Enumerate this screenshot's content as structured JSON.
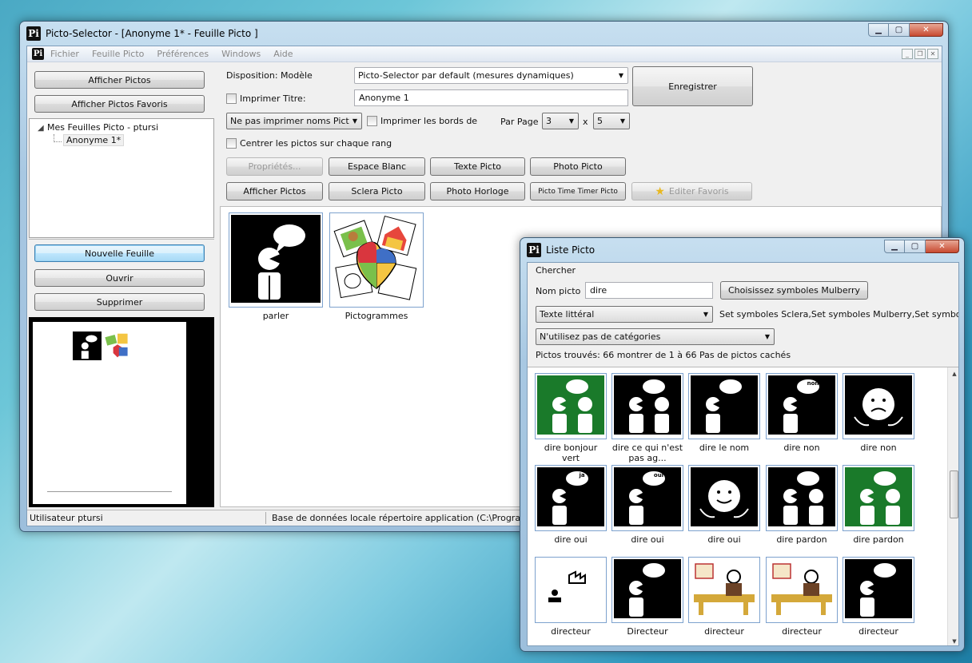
{
  "main_window": {
    "title": "Picto-Selector - [Anonyme 1* - Feuille Picto ]",
    "logo": "Pi",
    "menu": [
      "Fichier",
      "Feuille Picto",
      "Préférences",
      "Windows",
      "Aide"
    ]
  },
  "sidebar": {
    "show_pictos": "Afficher Pictos",
    "show_favorites": "Afficher Pictos Favoris",
    "tree_root": "Mes Feuilles Picto - ptursi",
    "tree_child": "Anonyme 1*",
    "new_sheet": "Nouvelle Feuille",
    "open": "Ouvrir",
    "delete": "Supprimer"
  },
  "options": {
    "layout_label": "Disposition: Modèle",
    "layout_value": "Picto-Selector par default (mesures dynamiques)",
    "save": "Enregistrer",
    "print_title_label": "Imprimer Titre:",
    "title_value": "Anonyme 1",
    "names_select": "Ne pas imprimer noms Pict",
    "print_borders": "Imprimer les bords de",
    "per_page": "Par Page",
    "rows": "3",
    "times": "x",
    "cols": "5",
    "center_label": "Centrer les pictos sur chaque rang"
  },
  "toolbar": {
    "properties": "Propriétés...",
    "white_space": "Espace Blanc",
    "text_picto": "Texte Picto",
    "photo_picto": "Photo Picto",
    "show_pictos": "Afficher Pictos",
    "sclera_picto": "Sclera Picto",
    "photo_clock": "Photo Horloge",
    "time_timer": "Picto Time Timer Picto",
    "edit_favorites": "Editer Favoris"
  },
  "sheet_pictos": [
    {
      "caption": "parler",
      "icon": "speaking-person-icon"
    },
    {
      "caption": "Pictogrammes",
      "icon": "pictograms-collage-icon"
    }
  ],
  "status": {
    "user": "Utilisateur ptursi",
    "db": "Base de données locale répertoire application (C:\\Program F"
  },
  "list_window": {
    "title": "Liste Picto",
    "search_group": "Chercher",
    "name_label": "Nom picto",
    "name_value": "dire",
    "choose_btn": "Choisissez symboles Mulberry",
    "text_mode": "Texte littéral",
    "symbol_sets": "Set symboles Sclera,Set symboles Mulberry,Set symbole",
    "categories": "N'utilisez pas de catégories",
    "found": "Pictos trouvés: 66 montrer de 1 à 66 Pas de pictos cachés",
    "results": [
      {
        "caption": "dire bonjour vert",
        "style": "green"
      },
      {
        "caption": "dire ce qui n'est pas ag...",
        "style": "black"
      },
      {
        "caption": "dire le nom",
        "style": "black"
      },
      {
        "caption": "dire non",
        "style": "black"
      },
      {
        "caption": "dire non",
        "style": "black"
      },
      {
        "caption": "dire oui",
        "style": "black"
      },
      {
        "caption": "dire oui",
        "style": "black"
      },
      {
        "caption": "dire oui",
        "style": "black"
      },
      {
        "caption": "dire pardon",
        "style": "black"
      },
      {
        "caption": "dire pardon",
        "style": "green"
      },
      {
        "caption": "directeur",
        "style": "white"
      },
      {
        "caption": "Directeur",
        "style": "black"
      },
      {
        "caption": "directeur",
        "style": "color"
      },
      {
        "caption": "directeur",
        "style": "color"
      },
      {
        "caption": "directeur",
        "style": "black"
      }
    ],
    "bubble_texts": [
      "non",
      "ja",
      "oui"
    ]
  }
}
